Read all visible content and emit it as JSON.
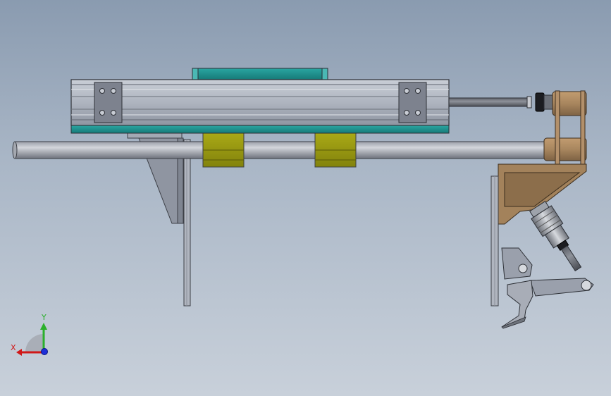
{
  "viewport": {
    "background_top": "#8a9bb0",
    "background_bottom": "#c8d0da"
  },
  "triad": {
    "y_label": "Y",
    "x_label": "X",
    "y_color": "#2bb02b",
    "x_color": "#d01818",
    "z_color": "#1e2fd8"
  },
  "colors": {
    "aluminum": "#b9bec8",
    "teal_plate": "#1e8f8c",
    "olive_block": "#9a9a12",
    "bracket_gray": "#9aa0ac",
    "wood_tan": "#a8865e",
    "rod_gray": "#7c8088"
  }
}
